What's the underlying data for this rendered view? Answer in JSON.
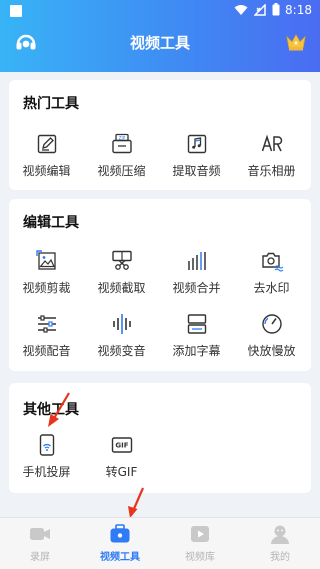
{
  "status_bar": {
    "time": "8:18"
  },
  "app": {
    "title": "视频工具"
  },
  "hot_tools": {
    "title": "热门工具",
    "items": [
      {
        "label": "视频编辑",
        "icon": "video-edit-icon"
      },
      {
        "label": "视频压缩",
        "icon": "zip-compress-icon"
      },
      {
        "label": "提取音频",
        "icon": "music-note-icon"
      },
      {
        "label": "音乐相册",
        "icon": "music-album-icon"
      }
    ]
  },
  "edit_tools": {
    "title": "编辑工具",
    "items": [
      {
        "label": "视频剪裁",
        "icon": "crop-icon"
      },
      {
        "label": "视频截取",
        "icon": "scissors-icon"
      },
      {
        "label": "视频合并",
        "icon": "merge-icon"
      },
      {
        "label": "去水印",
        "icon": "remove-watermark-icon"
      },
      {
        "label": "视频配音",
        "icon": "dubbing-icon"
      },
      {
        "label": "视频变音",
        "icon": "voice-change-icon"
      },
      {
        "label": "添加字幕",
        "icon": "subtitle-icon"
      },
      {
        "label": "快放慢放",
        "icon": "speed-icon"
      }
    ]
  },
  "other_tools": {
    "title": "其他工具",
    "items": [
      {
        "label": "手机投屏",
        "icon": "screen-cast-icon"
      },
      {
        "label": "转GIF",
        "icon": "gif-icon"
      }
    ]
  },
  "tabs": [
    {
      "label": "录屏",
      "icon": "camera-icon",
      "active": false
    },
    {
      "label": "视频工具",
      "icon": "toolbox-icon",
      "active": true
    },
    {
      "label": "视频库",
      "icon": "video-library-icon",
      "active": false
    },
    {
      "label": "我的",
      "icon": "profile-icon",
      "active": false
    }
  ],
  "colors": {
    "header_gradient_start": "#38b4f6",
    "header_gradient_end": "#4a6cf2",
    "accent": "#2f7af5",
    "annotation_arrow": "#e8341c",
    "crown": "#f5c542"
  }
}
